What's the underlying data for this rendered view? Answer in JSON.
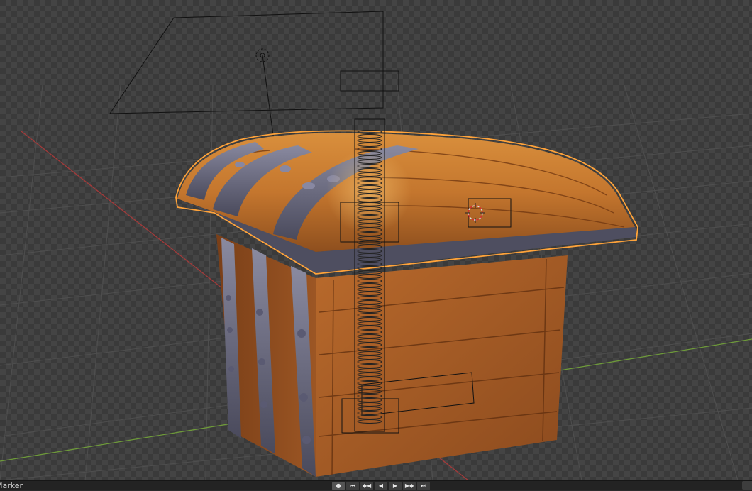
{
  "viewport": {
    "name": "3D Viewport",
    "selected_object": "Treasure Chest",
    "colors": {
      "background_dark": "#3a3a3a",
      "background_light": "#444444",
      "grid_line": "#525252",
      "x_axis": "#a33a3a",
      "y_axis": "#6e9a3a",
      "selection_outline": "#ffa33a",
      "wood": "#b5692c",
      "metal": "#5a5a6e"
    }
  },
  "footer": {
    "marker_label": "Marker",
    "playback": [
      {
        "name": "record-button",
        "glyph": "●"
      },
      {
        "name": "jump-start-button",
        "glyph": "⏮"
      },
      {
        "name": "prev-keyframe-button",
        "glyph": "◆◀"
      },
      {
        "name": "play-reverse-button",
        "glyph": "◀"
      },
      {
        "name": "play-button",
        "glyph": "▶"
      },
      {
        "name": "next-keyframe-button",
        "glyph": "▶◆"
      },
      {
        "name": "jump-end-button",
        "glyph": "⏭"
      }
    ]
  }
}
